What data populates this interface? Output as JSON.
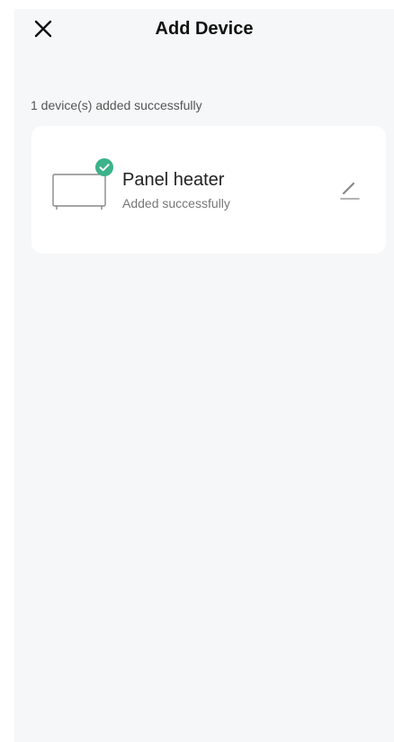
{
  "header": {
    "title": "Add Device",
    "close_icon": "close-icon"
  },
  "summary": {
    "text": "1 device(s) added successfully"
  },
  "devices": [
    {
      "name": "Panel heater",
      "status": "Added successfully",
      "icon": "panel-heater-icon",
      "badge_icon": "check-circle-icon",
      "edit_icon": "edit-pencil-icon"
    }
  ],
  "colors": {
    "background": "#f6f7f8",
    "card": "#ffffff",
    "success": "#3cb38a"
  }
}
